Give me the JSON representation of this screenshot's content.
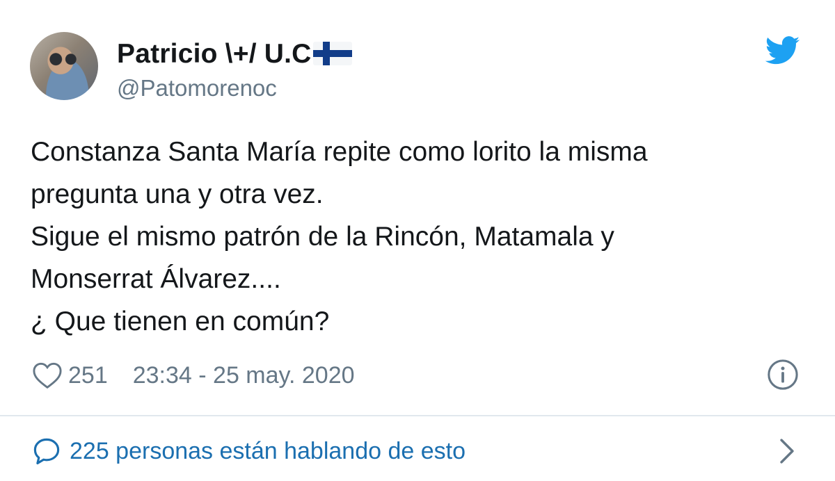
{
  "tweet": {
    "author": {
      "display_name": "Patricio \\+/ U.C",
      "handle": "@Patomorenoc",
      "flag_icon": "finland-flag-icon"
    },
    "text": "Constanza Santa María repite como lorito la misma\npregunta una y otra vez.\nSigue el mismo patrón de la Rincón, Matamala y\nMonserrat Álvarez....\n¿ Que tienen en común?",
    "likes": "251",
    "timestamp": "23:34 - 25 may. 2020",
    "conversation_label": "225 personas están hablando de esto"
  },
  "icons": {
    "brand": "twitter-bird-icon",
    "like": "heart-icon",
    "info": "info-icon",
    "conversation": "speech-bubble-icon",
    "navigate": "chevron-right-icon"
  },
  "colors": {
    "brand_blue": "#1da1f2",
    "link_blue": "#1b6fb0",
    "muted_gray": "#657786",
    "text": "#14171a",
    "divider": "#e1e8ed"
  }
}
